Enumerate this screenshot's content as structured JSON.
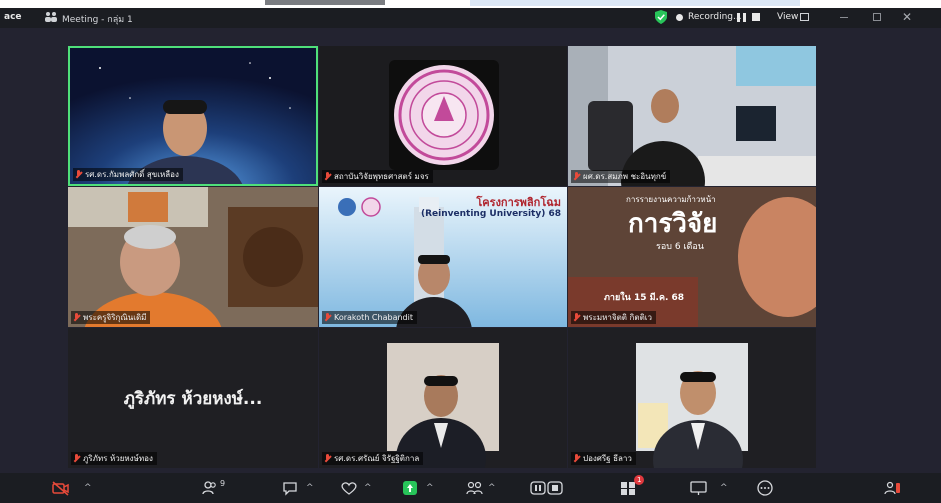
{
  "titlebar": {
    "app_partial": "ace",
    "meeting_title": "Meeting - กลุ่ม 1",
    "recording_label": "Recording...",
    "view_label": "View"
  },
  "participants": [
    {
      "name": "รศ.ดร.กัมพลศักดิ์ สุขเหลือง",
      "active": true,
      "scene": "space"
    },
    {
      "name": "สถาบันวิจัยพุทธศาสตร์ มจร",
      "active": false,
      "scene": "logo"
    },
    {
      "name": "ผศ.ดร.สมภพ ชะอินทุกข์",
      "active": false,
      "scene": "office"
    },
    {
      "name": "พระครูจิริกุณินเดิมี",
      "active": false,
      "scene": "monk-room"
    },
    {
      "name": "Korakoth Chabandit",
      "active": false,
      "scene": "banner"
    },
    {
      "name": "พระมหาจิตติ กิตติเว",
      "active": false,
      "scene": "research"
    },
    {
      "name": "ภูริภัทร ห้วยหงษ์ทอง",
      "active": false,
      "scene": "no-video",
      "display_name": "ภูริภัทร ห้วยหงษ์..."
    },
    {
      "name": "รศ.ดร.ศรัณย์ จิรัฐฐิติกาล",
      "active": false,
      "scene": "portrait"
    },
    {
      "name": "ปองศรีฐ ธีลาว",
      "active": false,
      "scene": "portrait2"
    }
  ],
  "banner_text": {
    "program_title": "โครงการพลิกโฉม",
    "program_subtitle": "(Reinventing University) 68"
  },
  "research_text": {
    "heading_small": "การรายงานความก้าวหน้า",
    "heading_big": "การวิจัย",
    "subheading": "รอบ 6 เดือน",
    "deadline": "ภายใน 15 มี.ค. 68"
  },
  "toolbar": {
    "participants_count": "9",
    "apps_badge": "1",
    "icons": [
      "video-off-icon",
      "participants-icon",
      "chat-icon",
      "react-icon",
      "share-icon",
      "host-tools-icon",
      "captions-icon",
      "apps-icon",
      "whiteboard-icon",
      "more-icon",
      "leave-icon"
    ]
  },
  "colors": {
    "active_border": "#4fe07a",
    "stage_bg": "#232330",
    "bar_bg": "#1b1d22",
    "share_green": "#28c45a",
    "muted_red": "#e84a3a"
  }
}
